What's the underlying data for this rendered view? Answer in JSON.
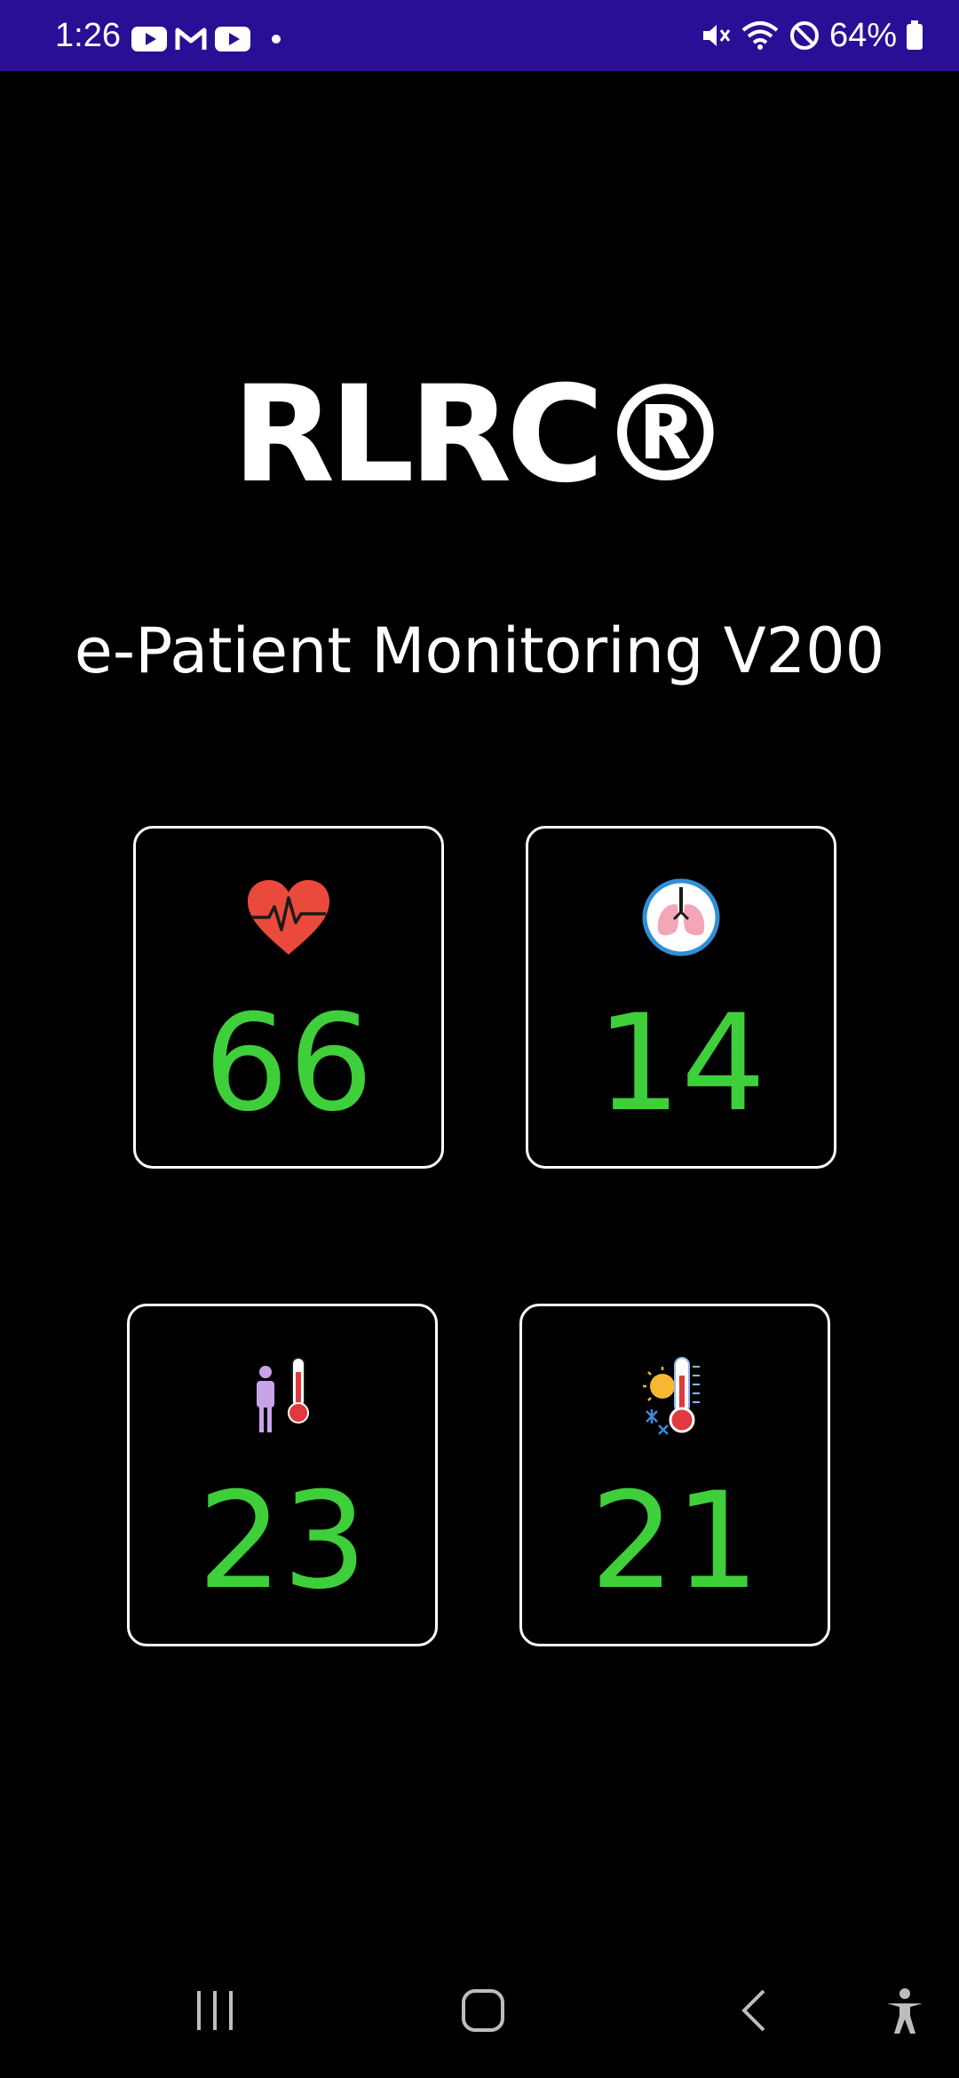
{
  "status_bar": {
    "time": "1:26",
    "left_icons": [
      "youtube-icon",
      "gmail-icon",
      "youtube-icon",
      "notification-dot-icon"
    ],
    "right_icons": [
      "mute-icon",
      "wifi-icon",
      "do-not-disturb-icon"
    ],
    "battery_percent": "64%",
    "background": "#2a0f96"
  },
  "brand": {
    "name": "RLRC®"
  },
  "subtitle": "e-Patient Monitoring V200",
  "tiles": [
    {
      "icon": "heart-rate-icon",
      "value": "66"
    },
    {
      "icon": "lungs-icon",
      "value": "14"
    },
    {
      "icon": "body-temperature-icon",
      "value": "23"
    },
    {
      "icon": "ambient-temperature-icon",
      "value": "21"
    }
  ],
  "colors": {
    "value_green": "#3ecf3a",
    "tile_border": "#ffffff",
    "background": "#000000"
  },
  "nav_bar": {
    "buttons": [
      "recent-apps-icon",
      "home-icon",
      "back-icon",
      "accessibility-icon"
    ]
  }
}
